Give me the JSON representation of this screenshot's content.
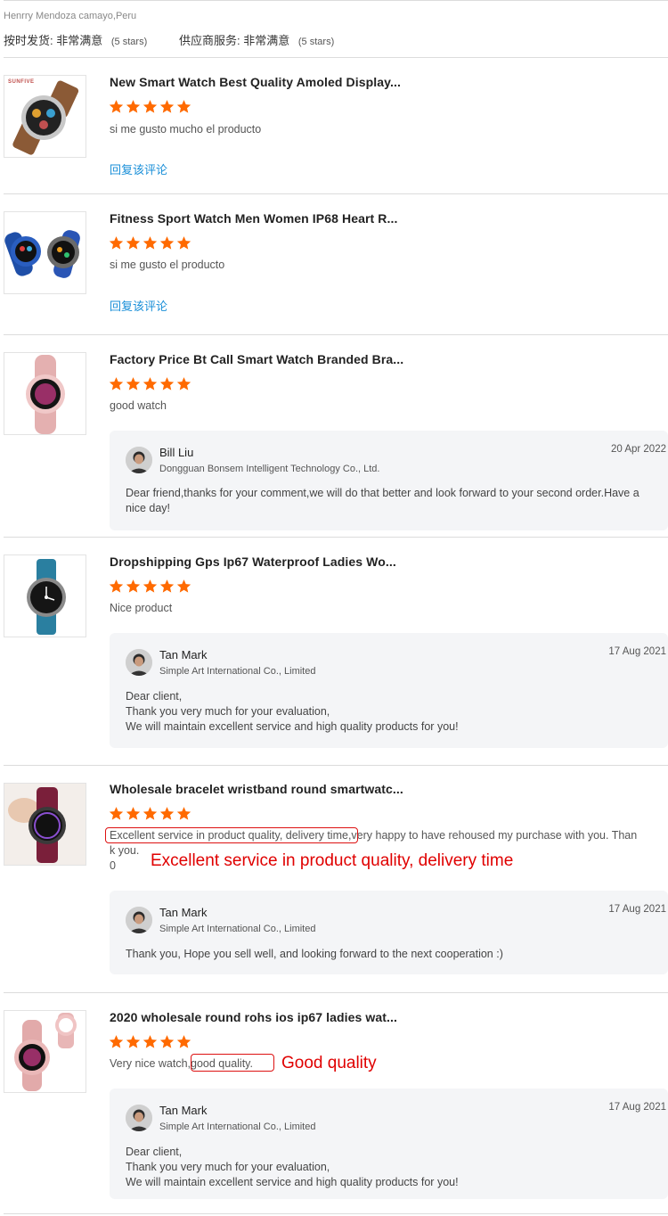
{
  "buyer": {
    "name": "Henrry Mendoza camayo,Peru",
    "on_time_label": "按时发货:",
    "on_time_value": "非常满意",
    "on_time_stars": "(5 stars)",
    "service_label": "供应商服务:",
    "service_value": "非常满意",
    "service_stars": "(5 stars)"
  },
  "colors": {
    "star": "#ff6a00",
    "link": "#1a8fd8",
    "annotation": "#e00000",
    "reply_bg": "#f4f5f7"
  },
  "reviews": [
    {
      "title": "New Smart Watch Best Quality Amoled Display...",
      "rating": 5,
      "comment": "si me gusto mucho el producto",
      "reply_link": "回复该评论",
      "thumb_brand": "SUNFIVE"
    },
    {
      "title": "Fitness Sport Watch Men Women IP68 Heart R...",
      "rating": 5,
      "comment": "si me gusto el producto",
      "reply_link": "回复该评论"
    },
    {
      "title": "Factory Price Bt Call Smart Watch Branded Bra...",
      "rating": 5,
      "comment": "good watch",
      "reply": {
        "name": "Bill Liu",
        "company": "Dongguan Bonsem Intelligent Technology Co., Ltd.",
        "date": "20 Apr 2022",
        "line1": "Dear friend,thanks for your comment,we will do that better and look forward to your second order.Have a",
        "line2": "nice day!"
      }
    },
    {
      "title": "Dropshipping Gps Ip67 Waterproof Ladies Wo...",
      "rating": 5,
      "comment": "Nice product",
      "reply": {
        "name": "Tan Mark",
        "company": "Simple Art International Co., Limited",
        "date": "17 Aug 2021",
        "line1": "Dear client,",
        "line2": "Thank you very much for your evaluation,",
        "line3": "We will maintain excellent service and high quality products for you!"
      }
    },
    {
      "title": "Wholesale bracelet wristband round smartwatc...",
      "rating": 5,
      "comment_highlight": "Excellent service in product quality, delivery time,",
      "comment_rest": "very happy to have rehoused my purchase with you. Than",
      "comment_line2": "k you.",
      "comment_line3": "0",
      "annotation": "Excellent service in product quality, delivery time",
      "reply": {
        "name": "Tan Mark",
        "company": "Simple Art International Co., Limited",
        "date": "17 Aug 2021",
        "line1": "Thank you, Hope you sell well, and looking forward to the next cooperation :)"
      }
    },
    {
      "title": "2020 wholesale round rohs ios ip67 ladies wat...",
      "rating": 5,
      "comment_prefix": "Very nice watch,",
      "comment_highlight": "good quality.",
      "annotation": "Good quality",
      "reply": {
        "name": "Tan Mark",
        "company": "Simple Art International Co., Limited",
        "date": "17 Aug 2021",
        "line1": "Dear client,",
        "line2": "Thank you very much for your evaluation,",
        "line3": "We will maintain excellent service and high quality products for you!"
      }
    }
  ]
}
